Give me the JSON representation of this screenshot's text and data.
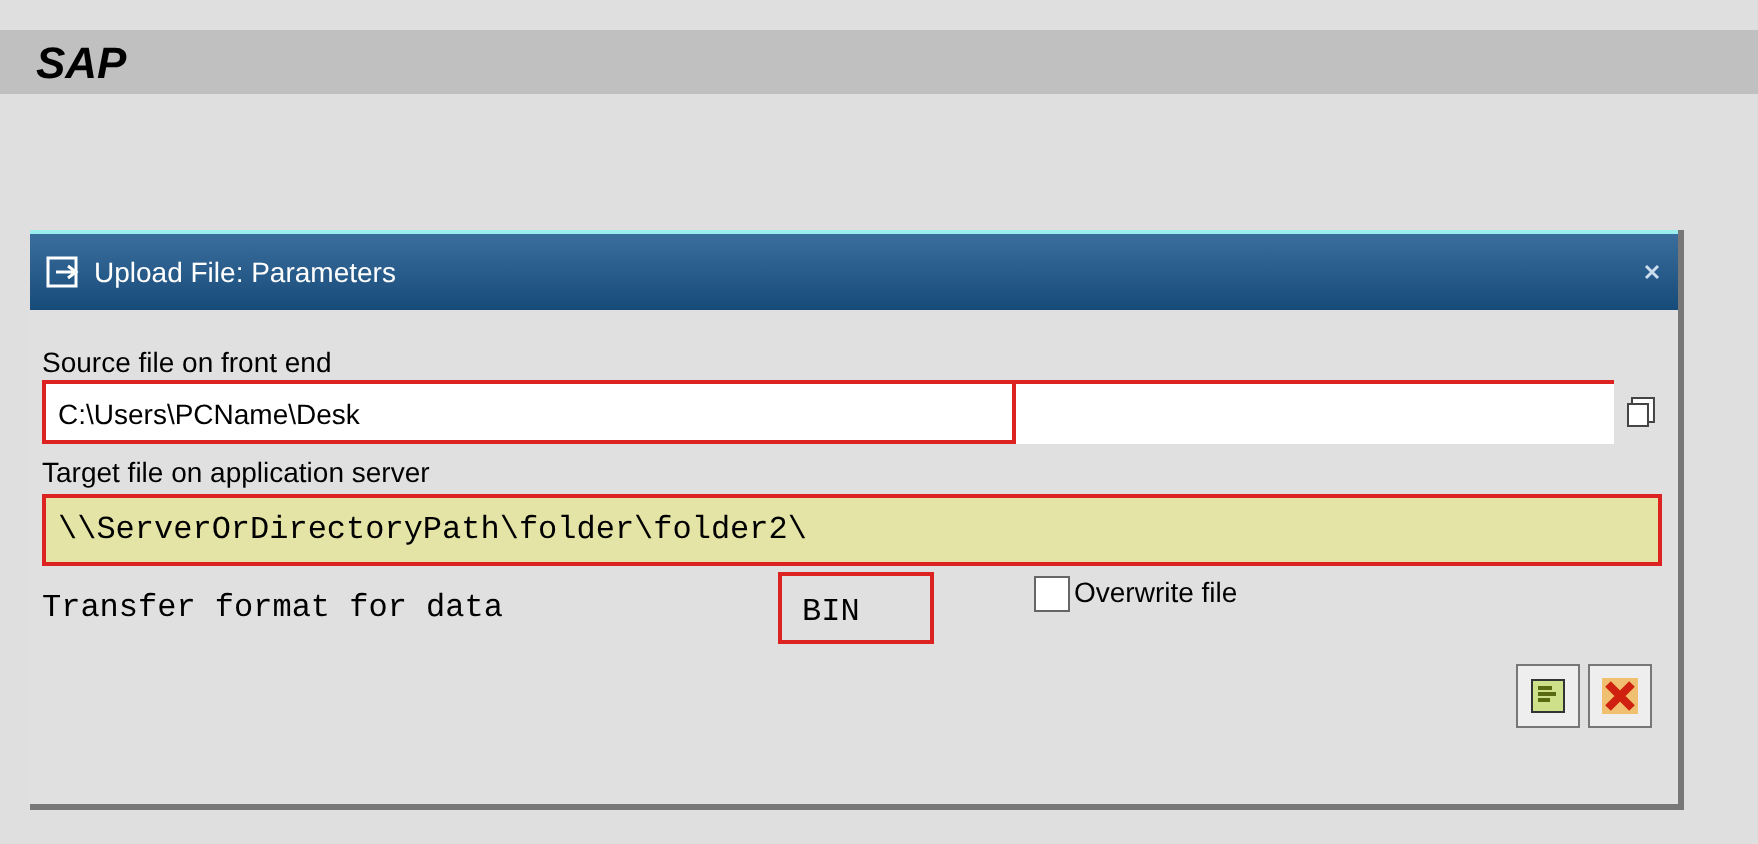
{
  "app": {
    "logo": "SAP"
  },
  "dialog": {
    "title": "Upload File: Parameters",
    "source": {
      "label": "Source file on front end",
      "value": "C:\\Users\\PCName\\Desk"
    },
    "target": {
      "label": "Target file on application server",
      "value": "\\\\ServerOrDirectoryPath\\folder\\folder2\\"
    },
    "format": {
      "label": "Transfer format for data",
      "value": "BIN"
    },
    "overwrite": {
      "label": "Overwrite file",
      "checked": false
    }
  }
}
